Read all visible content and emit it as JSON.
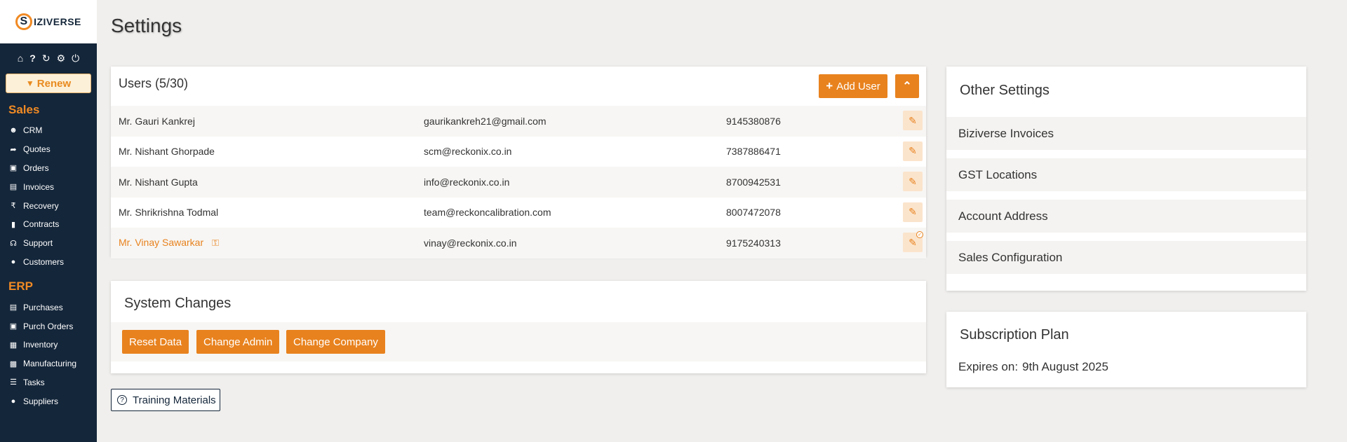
{
  "brand": {
    "logo_letter": "S",
    "logo_text": "IZIVERSE"
  },
  "sidebar": {
    "top_icons": [
      "home-icon",
      "help-icon",
      "refresh-icon",
      "gear-icon",
      "power-icon"
    ],
    "renew_label": "Renew",
    "sales_title": "Sales",
    "sales_items": [
      {
        "label": "CRM",
        "icon": "users-icon"
      },
      {
        "label": "Quotes",
        "icon": "share-icon"
      },
      {
        "label": "Orders",
        "icon": "cart-icon"
      },
      {
        "label": "Invoices",
        "icon": "money-icon"
      },
      {
        "label": "Recovery",
        "icon": "rupee-icon"
      },
      {
        "label": "Contracts",
        "icon": "file-icon"
      },
      {
        "label": "Support",
        "icon": "headset-icon"
      },
      {
        "label": "Customers",
        "icon": "globe-icon"
      }
    ],
    "erp_title": "ERP",
    "erp_items": [
      {
        "label": "Purchases",
        "icon": "money-icon"
      },
      {
        "label": "Purch Orders",
        "icon": "cart-icon"
      },
      {
        "label": "Inventory",
        "icon": "grid-icon"
      },
      {
        "label": "Manufacturing",
        "icon": "chart-icon"
      },
      {
        "label": "Tasks",
        "icon": "list-icon"
      },
      {
        "label": "Suppliers",
        "icon": "globe-icon"
      }
    ]
  },
  "page": {
    "title": "Settings"
  },
  "users": {
    "title": "Users (5/30)",
    "add_label": "Add User",
    "rows": [
      {
        "name": "Mr. Gauri Kankrej",
        "email": "gaurikankreh21@gmail.com",
        "phone": "9145380876"
      },
      {
        "name": "Mr. Nishant Ghorpade",
        "email": "scm@reckonix.co.in",
        "phone": "7387886471"
      },
      {
        "name": "Mr. Nishant Gupta",
        "email": "info@reckonix.co.in",
        "phone": "8700942531"
      },
      {
        "name": "Mr. Shrikrishna Todmal",
        "email": "team@reckoncalibration.com",
        "phone": "8007472078"
      },
      {
        "name": "Mr. Vinay Sawarkar",
        "email": "vinay@reckonix.co.in",
        "phone": "9175240313"
      }
    ]
  },
  "system_changes": {
    "title": "System Changes",
    "reset_label": "Reset Data",
    "change_admin_label": "Change Admin",
    "change_company_label": "Change Company"
  },
  "training": {
    "label": "Training Materials"
  },
  "other_settings": {
    "title": "Other Settings",
    "items": [
      "Biziverse Invoices",
      "GST Locations",
      "Account Address",
      "Sales Configuration"
    ]
  },
  "subscription": {
    "title": "Subscription Plan",
    "expires_label": "Expires on:",
    "expires_value": "9th August 2025"
  },
  "colors": {
    "accent": "#e8821e",
    "sidebar": "#14263a"
  }
}
